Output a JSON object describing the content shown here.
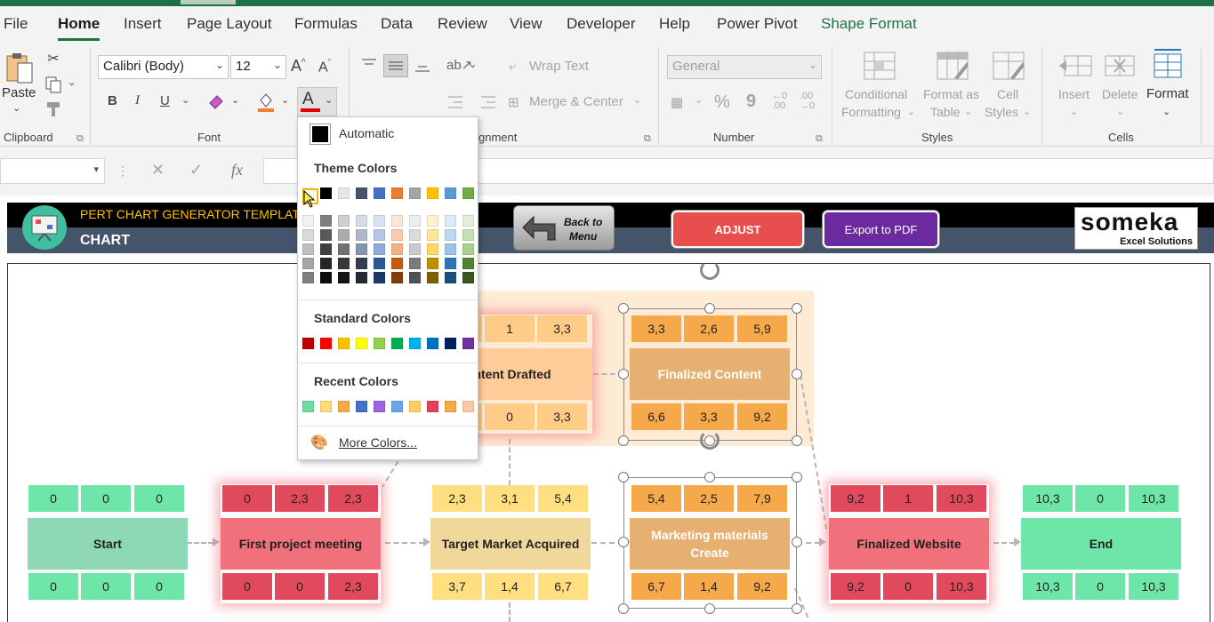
{
  "menu": {
    "tabs": [
      "File",
      "Home",
      "Insert",
      "Page Layout",
      "Formulas",
      "Data",
      "Review",
      "View",
      "Developer",
      "Help",
      "Power Pivot",
      "Shape Format"
    ]
  },
  "ribbon": {
    "clipboard": {
      "paste": "Paste",
      "label": "Clipboard"
    },
    "font": {
      "name": "Calibri (Body)",
      "size": "12",
      "label": "Font",
      "bold": "B",
      "italic": "I",
      "underline": "U"
    },
    "alignment": {
      "wrap": "Wrap Text",
      "merge": "Merge & Center",
      "label": "Alignment",
      "label_visible": "gnment"
    },
    "number": {
      "format": "General",
      "label": "Number",
      "percent": "%",
      "comma": "9"
    },
    "styles": {
      "conditional": "Conditional",
      "formatting": "Formatting",
      "format_as": "Format as",
      "table": "Table",
      "cell": "Cell",
      "cell_styles": "Styles",
      "label": "Styles"
    },
    "cells": {
      "insert": "Insert",
      "delete": "Delete",
      "format": "Format",
      "label": "Cells"
    }
  },
  "formula_bar": {
    "fx": "fx"
  },
  "header": {
    "title": "PERT CHART GENERATOR TEMPLATE",
    "subtitle": "CHART",
    "back_line1": "Back to",
    "back_line2": "Menu",
    "adjust": "ADJUST",
    "export": "Export to PDF",
    "logo_big": "someka",
    "logo_small": "Excel Solutions"
  },
  "color_menu": {
    "automatic": "Automatic",
    "theme": "Theme Colors",
    "standard": "Standard Colors",
    "recent": "Recent Colors",
    "more": "More Colors...",
    "theme_top": [
      "#ffffff",
      "#000000",
      "#e7e6e6",
      "#44546a",
      "#4472c4",
      "#ed7d31",
      "#a5a5a5",
      "#ffc000",
      "#5b9bd5",
      "#70ad47"
    ],
    "theme_cols": [
      [
        "#f2f2f2",
        "#d9d9d9",
        "#bfbfbf",
        "#a6a6a6",
        "#808080"
      ],
      [
        "#808080",
        "#595959",
        "#404040",
        "#262626",
        "#0d0d0d"
      ],
      [
        "#d0cece",
        "#aeabab",
        "#757171",
        "#3b3838",
        "#161616"
      ],
      [
        "#d6dce5",
        "#adb9ca",
        "#8497b0",
        "#333f50",
        "#222a35"
      ],
      [
        "#dae3f3",
        "#b4c7e7",
        "#8faadc",
        "#2f5597",
        "#203864"
      ],
      [
        "#fbe5d6",
        "#f8cbad",
        "#f4b183",
        "#c55a11",
        "#843c0c"
      ],
      [
        "#ededed",
        "#dbdbdb",
        "#c9c9c9",
        "#7b7b7b",
        "#525252"
      ],
      [
        "#fff2cc",
        "#ffe699",
        "#ffd966",
        "#bf9000",
        "#7f6000"
      ],
      [
        "#deebf7",
        "#bdd7ee",
        "#9dc3e6",
        "#2e75b6",
        "#1f4e79"
      ],
      [
        "#e2f0d9",
        "#c5e0b4",
        "#a9d18e",
        "#548235",
        "#385723"
      ]
    ],
    "standard_colors": [
      "#c00000",
      "#ff0000",
      "#ffc000",
      "#ffff00",
      "#92d050",
      "#00b050",
      "#00b0f0",
      "#0070c0",
      "#002060",
      "#7030a0"
    ],
    "recent_colors": [
      "#6fdaa4",
      "#ffd97a",
      "#f5a94a",
      "#4472c4",
      "#9966dd",
      "#6aa5e8",
      "#ffcc66",
      "#e0415a",
      "#f5a94a",
      "#f8c8a8"
    ]
  },
  "nodes": [
    {
      "id": "start",
      "title": "Start",
      "top": [
        "0",
        "0",
        "0"
      ],
      "bottom": [
        "0",
        "0",
        "0"
      ],
      "color": "#6ee6a9",
      "body": "#8fd8b5"
    },
    {
      "id": "meeting",
      "title": "First project meeting",
      "top": [
        "0",
        "2,3",
        "2,3"
      ],
      "bottom": [
        "0",
        "0",
        "2,3"
      ],
      "color": "#e14a5c",
      "body": "#f0707c"
    },
    {
      "id": "market",
      "title": "Target Market Acquired",
      "top": [
        "2,3",
        "3,1",
        "5,4"
      ],
      "bottom": [
        "3,7",
        "1,4",
        "6,7"
      ],
      "color": "#ffdf80",
      "body": "#f0d89a"
    },
    {
      "id": "marketing",
      "title": "Marketing materials Create",
      "top": [
        "5,4",
        "2,5",
        "7,9"
      ],
      "bottom": [
        "6,7",
        "1,4",
        "9,2"
      ],
      "color": "#f5a94a",
      "body": "#e5b070"
    },
    {
      "id": "website",
      "title": "Finalized Website",
      "top": [
        "9,2",
        "1",
        "10,3"
      ],
      "bottom": [
        "9,2",
        "0",
        "10,3"
      ],
      "color": "#e14a5c",
      "body": "#f0707c"
    },
    {
      "id": "end",
      "title": "End",
      "top": [
        "10,3",
        "0",
        "10,3"
      ],
      "bottom": [
        "10,3",
        "0",
        "10,3"
      ],
      "color": "#6ee6a9",
      "body": "#6ee6a9"
    },
    {
      "id": "drafted",
      "title": "Content Drafted",
      "title_visible": "ntent Drafted",
      "top": [
        "",
        "1",
        "3,3"
      ],
      "bottom": [
        "",
        "0",
        "3,3"
      ],
      "color": "#ffcc88",
      "body": "#ffcc99"
    },
    {
      "id": "finalized",
      "title": "Finalized Content",
      "top": [
        "3,3",
        "2,6",
        "5,9"
      ],
      "bottom": [
        "6,6",
        "3,3",
        "9,2"
      ],
      "color": "#f5a94a",
      "body": "#e5b070"
    }
  ]
}
